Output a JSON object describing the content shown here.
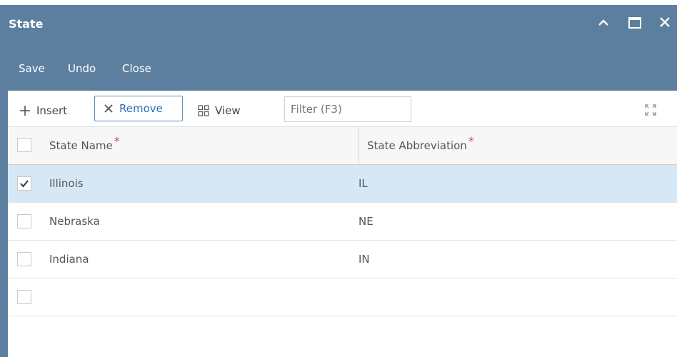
{
  "window": {
    "title": "State"
  },
  "menu": {
    "save": "Save",
    "undo": "Undo",
    "close": "Close"
  },
  "toolbar": {
    "insert": "Insert",
    "remove": "Remove",
    "view": "View",
    "filter_placeholder": "Filter (F3)"
  },
  "grid": {
    "columns": [
      {
        "label": "State Name",
        "required_mark": "*"
      },
      {
        "label": "State Abbreviation",
        "required_mark": "*"
      }
    ],
    "rows": [
      {
        "name": "Illinois",
        "abbr": "IL",
        "checked": true
      },
      {
        "name": "Nebraska",
        "abbr": "NE",
        "checked": false
      },
      {
        "name": "Indiana",
        "abbr": "IN",
        "checked": false
      },
      {
        "name": "",
        "abbr": "",
        "checked": false
      }
    ]
  },
  "colors": {
    "titlebar": "#5d7f9f",
    "selected_row": "#d6e8f6",
    "remove_accent": "#2a6fb5",
    "required": "#e24b4b"
  }
}
